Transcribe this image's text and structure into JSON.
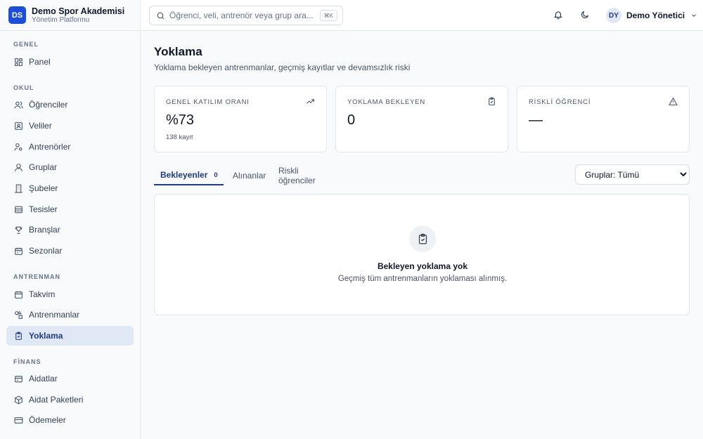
{
  "brand": {
    "logo": "DS",
    "name": "Demo Spor Akademisi",
    "subtitle": "Yönetim Platformu",
    "accent": "#1d4ed8"
  },
  "sidebar": {
    "sections": [
      {
        "title": "GENEL"
      },
      {
        "title": "OKUL"
      },
      {
        "title": "ANTRENMAN"
      },
      {
        "title": "FİNANS"
      }
    ],
    "items": [
      {
        "label": "Panel",
        "icon": "dashboard-icon"
      },
      {
        "label": "Öğrenciler",
        "icon": "users-icon"
      },
      {
        "label": "Veliler",
        "icon": "contact-icon"
      },
      {
        "label": "Antrenörler",
        "icon": "coach-icon"
      },
      {
        "label": "Gruplar",
        "icon": "user-icon"
      },
      {
        "label": "Şubeler",
        "icon": "building-icon"
      },
      {
        "label": "Tesisler",
        "icon": "facility-icon"
      },
      {
        "label": "Branşlar",
        "icon": "trophy-icon"
      },
      {
        "label": "Sezonlar",
        "icon": "calendar-icon"
      },
      {
        "label": "Takvim",
        "icon": "calendar-icon"
      },
      {
        "label": "Antrenmanlar",
        "icon": "shapes-icon"
      },
      {
        "label": "Yoklama",
        "icon": "clipboard-check-icon",
        "active": true
      },
      {
        "label": "Aidatlar",
        "icon": "receipt-icon"
      },
      {
        "label": "Aidat Paketleri",
        "icon": "package-icon"
      },
      {
        "label": "Ödemeler",
        "icon": "credit-card-icon"
      }
    ]
  },
  "topbar": {
    "search_placeholder": "Öğrenci, veli, antrenör veya grup ara...",
    "shortcut": "⌘K",
    "user_initials": "DY",
    "user_name": "Demo Yönetici"
  },
  "page": {
    "title": "Yoklama",
    "subtitle": "Yoklama bekleyen antrenmanlar, geçmiş kayıtlar ve devamsızlık riski"
  },
  "stats": [
    {
      "label": "GENEL KATILIM ORANI",
      "value": "%73",
      "note": "138 kayıt",
      "icon": "trend-up-icon"
    },
    {
      "label": "YOKLAMA BEKLEYEN",
      "value": "0",
      "note": "",
      "icon": "clipboard-check-icon"
    },
    {
      "label": "RİSKLİ ÖĞRENCİ",
      "value": "—",
      "note": "",
      "icon": "warning-icon"
    }
  ],
  "tabs": [
    {
      "label": "Bekleyenler",
      "badge": "0",
      "active": true
    },
    {
      "label": "Alınanlar"
    },
    {
      "label": "Riskli öğrenciler"
    }
  ],
  "filter": {
    "selected": "Gruplar: Tümü",
    "options": [
      "Gruplar: Tümü"
    ]
  },
  "empty_state": {
    "title": "Bekleyen yoklama yok",
    "description": "Geçmiş tüm antrenmanların yoklaması alınmış."
  }
}
